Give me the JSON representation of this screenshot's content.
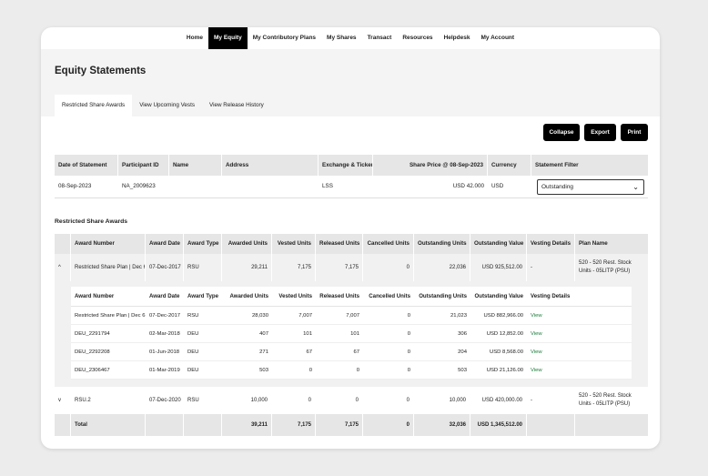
{
  "nav": [
    "Home",
    "My Equity",
    "My Contributory Plans",
    "My Shares",
    "Transact",
    "Resources",
    "Helpdesk",
    "My Account"
  ],
  "nav_active": "My Equity",
  "page_title": "Equity Statements",
  "tabs": [
    "Restricted Share Awards",
    "View Upcoming Vests",
    "View Release History"
  ],
  "actions": {
    "collapse": "Collapse",
    "export": "Export",
    "print": "Print"
  },
  "statement": {
    "headers": {
      "date": "Date of Statement",
      "participant": "Participant ID",
      "name": "Name",
      "address": "Address",
      "exchange": "Exchange & Ticker",
      "price": "Share Price @ 08-Sep-2023",
      "currency": "Currency",
      "filter": "Statement Filter"
    },
    "values": {
      "date": "08-Sep-2023",
      "participant": "NA_2009623",
      "name": "",
      "address": "",
      "exchange": "LSS",
      "price": "USD 42.000",
      "currency": "USD",
      "filter": "Outstanding"
    }
  },
  "section_title": "Restricted Share Awards",
  "awards": {
    "headers": {
      "number": "Award Number",
      "date": "Award Date",
      "type": "Award Type",
      "awarded": "Awarded Units",
      "vested": "Vested Units",
      "released": "Released Units",
      "cancelled": "Cancelled Units",
      "outstanding": "Outstanding Units",
      "ovalue": "Outstanding Value",
      "vesting": "Vesting Details",
      "plan": "Plan Name"
    },
    "row1": {
      "expander": "^",
      "number": "Restricted Share Plan | Dec 6",
      "date": "07-Dec-2017",
      "type": "RSU",
      "awarded": "29,211",
      "vested": "7,175",
      "released": "7,175",
      "cancelled": "0",
      "outstanding": "22,036",
      "ovalue": "USD 925,512.00",
      "vesting": "-",
      "plan": "520 - 520 Rest. Stock Units - 05LITP (PSU)"
    },
    "nested": {
      "headers": {
        "number": "Award Number",
        "date": "Award Date",
        "type": "Award Type",
        "awarded": "Awarded Units",
        "vested": "Vested Units",
        "released": "Released Units",
        "cancelled": "Cancelled Units",
        "outstanding": "Outstanding Units",
        "ovalue": "Outstanding Value",
        "vesting": "Vesting Details"
      },
      "rows": [
        {
          "number": "Restricted Share Plan | Dec 6",
          "date": "07-Dec-2017",
          "type": "RSU",
          "awarded": "28,030",
          "vested": "7,007",
          "released": "7,007",
          "cancelled": "0",
          "outstanding": "21,023",
          "ovalue": "USD 882,966.00",
          "vesting": "View"
        },
        {
          "number": "DEU_2291794",
          "date": "02-Mar-2018",
          "type": "DEU",
          "awarded": "407",
          "vested": "101",
          "released": "101",
          "cancelled": "0",
          "outstanding": "306",
          "ovalue": "USD 12,852.00",
          "vesting": "View"
        },
        {
          "number": "DEU_2292208",
          "date": "01-Jun-2018",
          "type": "DEU",
          "awarded": "271",
          "vested": "67",
          "released": "67",
          "cancelled": "0",
          "outstanding": "204",
          "ovalue": "USD 8,568.00",
          "vesting": "View"
        },
        {
          "number": "DEU_2306467",
          "date": "01-Mar-2019",
          "type": "DEU",
          "awarded": "503",
          "vested": "0",
          "released": "0",
          "cancelled": "0",
          "outstanding": "503",
          "ovalue": "USD 21,126.00",
          "vesting": "View"
        }
      ]
    },
    "row2": {
      "expander": "v",
      "number": "RSU.2",
      "date": "07-Dec-2020",
      "type": "RSU",
      "awarded": "10,000",
      "vested": "0",
      "released": "0",
      "cancelled": "0",
      "outstanding": "10,000",
      "ovalue": "USD 420,000.00",
      "vesting": "-",
      "plan": "520 - 520 Rest. Stock Units - 05LITP (PSU)"
    },
    "total": {
      "label": "Total",
      "awarded": "39,211",
      "vested": "7,175",
      "released": "7,175",
      "cancelled": "0",
      "outstanding": "32,036",
      "ovalue": "USD 1,345,512.00"
    }
  }
}
